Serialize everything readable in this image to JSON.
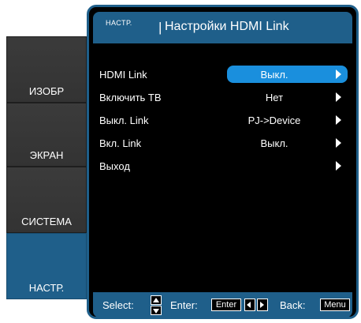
{
  "tabs": [
    {
      "label": "ИЗОБР"
    },
    {
      "label": "ЭКРАН"
    },
    {
      "label": "СИСТЕМА"
    },
    {
      "label": "НАСТР.",
      "active": true
    }
  ],
  "header": {
    "section": "НАСТР.",
    "separator": "|",
    "title": "Настройки HDMI Link"
  },
  "rows": [
    {
      "label": "HDMI Link",
      "value": "Выкл.",
      "selected": true
    },
    {
      "label": "Включить ТВ",
      "value": "Нет"
    },
    {
      "label": "Выкл. Link",
      "value": "PJ->Device"
    },
    {
      "label": "Вкл. Link",
      "value": "Выкл."
    },
    {
      "label": "Выход",
      "value": ""
    }
  ],
  "help": {
    "select_label": "Select:",
    "enter_label": "Enter:",
    "enter_key": "Enter",
    "back_label": "Back:",
    "menu_key": "Menu"
  },
  "colors": {
    "accent": "#1f5f8a",
    "highlight": "#1a8fdd",
    "tab_bg": "#383838",
    "panel_bg": "#000000"
  }
}
